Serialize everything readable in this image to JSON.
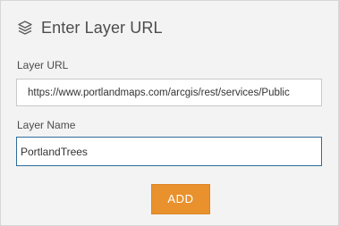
{
  "dialog": {
    "title": "Enter Layer URL",
    "title_icon": "layers-icon"
  },
  "form": {
    "url_label": "Layer URL",
    "url_value": "https://www.portlandmaps.com/arcgis/rest/services/Public",
    "name_label": "Layer Name",
    "name_value": "PortlandTrees"
  },
  "actions": {
    "add_label": "ADD"
  },
  "colors": {
    "accent": "#e8912d",
    "focus_border": "#2f6d9b",
    "panel_background": "#f3f3f3"
  }
}
